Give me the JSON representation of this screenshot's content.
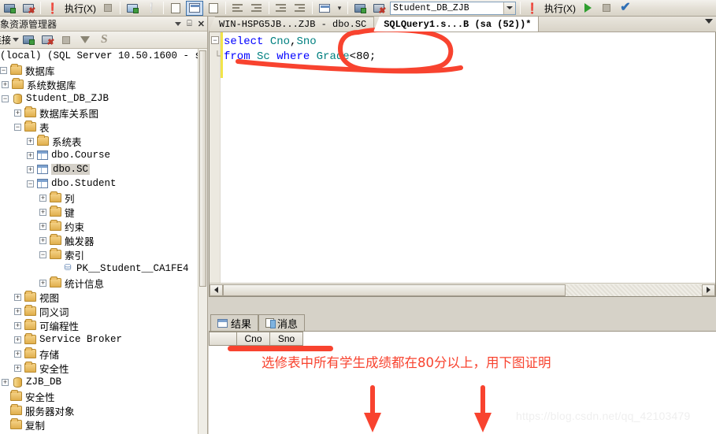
{
  "toolbar": {
    "execute_label_1": "执行(X)",
    "execute_label_2": "执行(X)",
    "database_value": "Student_DB_ZJB",
    "icons": [
      "server-connect-icon",
      "server-disconnect-icon",
      "execute-warning-icon",
      "stop-icon",
      "parse-icon",
      "debug-icon",
      "display-estimated-plan-icon",
      "include-actual-plan-icon",
      "include-client-statistics-icon",
      "results-to-text-icon",
      "results-to-grid-icon",
      "results-to-file-icon",
      "comment-icon",
      "uncomment-icon",
      "decrease-indent-icon",
      "increase-indent-icon",
      "specify-values-icon",
      "overflow-icon",
      "connect-icon",
      "change-connection-icon"
    ]
  },
  "object_explorer": {
    "title": "对象资源管理器",
    "connect_label": "连接",
    "toolbar_icons": [
      "connect-icon",
      "disconnect-icon",
      "stop-icon",
      "filter-icon",
      "refresh-icon"
    ],
    "window_controls": [
      "chevron-down-icon",
      "pin-icon",
      "close-icon"
    ],
    "tree": [
      {
        "label": "(local) (SQL Server 10.50.1600 - s",
        "indent": 0,
        "state": "expanded-clipped",
        "icon": "server-icon"
      },
      {
        "label": "数据库",
        "indent": 0,
        "state": "expanded",
        "icon": "folder-icon"
      },
      {
        "label": "系统数据库",
        "indent": 1,
        "state": "collapsed",
        "icon": "folder-icon"
      },
      {
        "label": "Student_DB_ZJB",
        "indent": 1,
        "state": "expanded",
        "icon": "database-icon"
      },
      {
        "label": "数据库关系图",
        "indent": 2,
        "state": "collapsed",
        "icon": "folder-icon"
      },
      {
        "label": "表",
        "indent": 2,
        "state": "expanded",
        "icon": "folder-icon"
      },
      {
        "label": "系统表",
        "indent": 3,
        "state": "collapsed",
        "icon": "folder-icon"
      },
      {
        "label": "dbo.Course",
        "indent": 3,
        "state": "collapsed",
        "icon": "table-icon"
      },
      {
        "label": "dbo.SC",
        "indent": 3,
        "state": "collapsed",
        "icon": "table-icon",
        "selected": true
      },
      {
        "label": "dbo.Student",
        "indent": 3,
        "state": "expanded",
        "icon": "table-icon"
      },
      {
        "label": "列",
        "indent": 4,
        "state": "collapsed",
        "icon": "folder-icon"
      },
      {
        "label": "键",
        "indent": 4,
        "state": "collapsed",
        "icon": "folder-icon"
      },
      {
        "label": "约束",
        "indent": 4,
        "state": "collapsed",
        "icon": "folder-icon"
      },
      {
        "label": "触发器",
        "indent": 4,
        "state": "collapsed",
        "icon": "folder-icon"
      },
      {
        "label": "索引",
        "indent": 4,
        "state": "expanded",
        "icon": "folder-icon"
      },
      {
        "label": "PK__Student__CA1FE4",
        "indent": 5,
        "state": "leaf",
        "icon": "index-icon"
      },
      {
        "label": "统计信息",
        "indent": 4,
        "state": "collapsed",
        "icon": "folder-icon"
      },
      {
        "label": "视图",
        "indent": 2,
        "state": "collapsed",
        "icon": "folder-icon"
      },
      {
        "label": "同义词",
        "indent": 2,
        "state": "collapsed",
        "icon": "folder-icon"
      },
      {
        "label": "可编程性",
        "indent": 2,
        "state": "collapsed",
        "icon": "folder-icon"
      },
      {
        "label": "Service Broker",
        "indent": 2,
        "state": "collapsed",
        "icon": "folder-icon"
      },
      {
        "label": "存储",
        "indent": 2,
        "state": "collapsed",
        "icon": "folder-icon"
      },
      {
        "label": "安全性",
        "indent": 2,
        "state": "collapsed",
        "icon": "folder-icon"
      },
      {
        "label": "ZJB_DB",
        "indent": 1,
        "state": "collapsed",
        "icon": "database-icon"
      },
      {
        "label": "安全性",
        "indent": 0,
        "state": "none",
        "icon": "folder-icon"
      },
      {
        "label": "服务器对象",
        "indent": 0,
        "state": "none",
        "icon": "folder-icon"
      },
      {
        "label": "复制",
        "indent": 0,
        "state": "none",
        "icon": "folder-icon"
      }
    ]
  },
  "editor": {
    "tabs": [
      {
        "label": "WIN-HSPG5JB...ZJB - dbo.SC",
        "active": false
      },
      {
        "label": "SQLQuery1.s...B (sa (52))*",
        "active": true
      }
    ],
    "code_lines": [
      {
        "outline": "minus",
        "tokens": [
          {
            "t": "select ",
            "k": "kw"
          },
          {
            "t": "Cno",
            "k": "id"
          },
          {
            "t": ",",
            "k": "op"
          },
          {
            "t": "Sno",
            "k": "id"
          }
        ]
      },
      {
        "outline": "end",
        "tokens": [
          {
            "t": "from ",
            "k": "kw"
          },
          {
            "t": "Sc ",
            "k": "id"
          },
          {
            "t": "where ",
            "k": "kw"
          },
          {
            "t": "Grade",
            "k": "id"
          },
          {
            "t": "<80;",
            "k": "op"
          }
        ]
      }
    ]
  },
  "results": {
    "tabs": [
      {
        "label": "结果",
        "icon": "grid-icon",
        "active": true
      },
      {
        "label": "消息",
        "icon": "message-icon",
        "active": false
      }
    ],
    "columns": [
      "",
      "Cno",
      "Sno"
    ],
    "rows": []
  },
  "annotations": {
    "note_text": "选修表中所有学生成绩都在80分以上，用下图证明",
    "note_color": "#f8432f",
    "shapes": [
      "circle-around-grade-condition",
      "underline-under-from-clause",
      "underline-left-of-note",
      "down-arrow-left",
      "down-arrow-right"
    ]
  },
  "watermark": "https://blog.csdn.net/qq_42103479"
}
